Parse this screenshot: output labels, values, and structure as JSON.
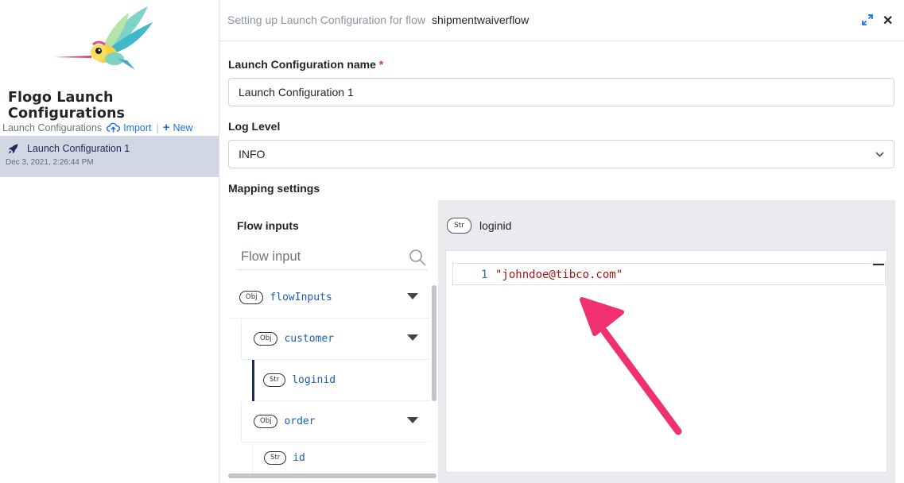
{
  "sidebar": {
    "app_title": "Flogo Launch Configurations",
    "section_label": "Launch Configurations",
    "import_label": "Import",
    "new_label": "New",
    "items": [
      {
        "name": "Launch Configuration 1",
        "date": "Dec 3, 2021, 2:26:44 PM"
      }
    ]
  },
  "topbar": {
    "title_prefix": "Setting up Launch Configuration for flow",
    "flow_name": "shipmentwaiverflow"
  },
  "form": {
    "name_label": "Launch Configuration name",
    "required_mark": "*",
    "name_value": "Launch Configuration 1",
    "log_level_label": "Log Level",
    "log_level_value": "INFO",
    "mapping_label": "Mapping settings"
  },
  "mapping": {
    "flow_inputs_title": "Flow inputs",
    "search_placeholder": "Flow input",
    "tree": [
      {
        "type": "Obj",
        "name": "flowInputs"
      },
      {
        "type": "Obj",
        "name": "customer"
      },
      {
        "type": "Str",
        "name": "loginid"
      },
      {
        "type": "Obj",
        "name": "order"
      },
      {
        "type": "Str",
        "name": "id"
      }
    ],
    "editor": {
      "type": "Str",
      "field": "loginid",
      "line_number": "1",
      "code": "\"johndoe@tibco.com\""
    }
  },
  "colors": {
    "accent": "#1a73e8",
    "selected_bg": "#d1d7e3",
    "annotation_arrow": "#f0306f",
    "string_literal": "#a31515"
  }
}
